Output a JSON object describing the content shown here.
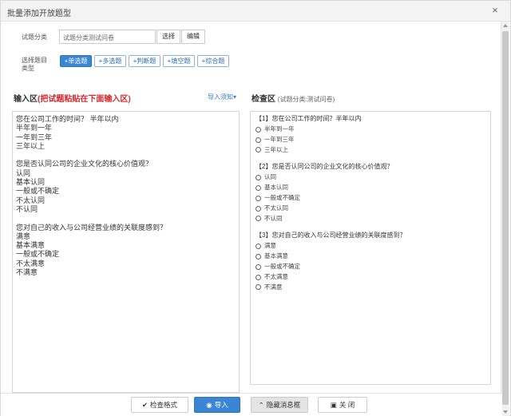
{
  "dialog": {
    "title": "批量添加开放题型",
    "close_glyph": "×"
  },
  "category": {
    "label": "试题分类",
    "value": "试题分类测试问卷",
    "select_label": "选择",
    "edit_label": "编辑"
  },
  "question_types": {
    "label_line1": "选择题目",
    "label_line2": "类型",
    "items": [
      {
        "label": "单选题",
        "active": true
      },
      {
        "label": "多选题",
        "active": false
      },
      {
        "label": "判断题",
        "active": false
      },
      {
        "label": "填空题",
        "active": false
      },
      {
        "label": "综合题",
        "active": false
      }
    ],
    "plus": "+"
  },
  "input_area": {
    "title_a": "输入区",
    "title_b": "(把试题粘贴在下面输入区)",
    "help_label": "导入须知",
    "help_glyph": "▾",
    "lines": [
      "您在公司工作的时间？ 半年以内",
      "半年到一年",
      "一年到三年",
      "三年以上",
      "",
      "您是否认同公司的企业文化的核心价值观？",
      "认同",
      "基本认同",
      "一般或不确定",
      "不太认同",
      "不认同",
      "",
      "您对自己的收入与公司经营业绩的关联度感到？",
      "满意",
      "基本满意",
      "一般或不确定",
      "不太满意",
      "不满意"
    ]
  },
  "check_area": {
    "title": "检查区",
    "subtitle": "(试题分类:测试问卷)",
    "questions": [
      {
        "title": "【1】您在公司工作的时间？半年以内",
        "options": [
          "半年到一年",
          "一年到三年",
          "三年以上"
        ]
      },
      {
        "title": "【2】您是否认同公司的企业文化的核心价值观？",
        "options": [
          "认同",
          "基本认同",
          "一般或不确定",
          "不太认同",
          "不认同"
        ]
      },
      {
        "title": "【3】您对自己的收入与公司经营业绩的关联度感到？",
        "options": [
          "满意",
          "基本满意",
          "一般或不确定",
          "不太满意",
          "不满意"
        ]
      }
    ]
  },
  "footer": {
    "check_format": "检查格式",
    "check_icon": "✔",
    "import": "导入",
    "import_icon": "◉",
    "hide_message": "隐藏消息框",
    "hide_icon": "⌃",
    "close": "关 闭",
    "close_icon": "▣"
  },
  "colors": {
    "accent": "#3a86d4",
    "red": "#d9272e",
    "link": "#3a7bc8"
  }
}
